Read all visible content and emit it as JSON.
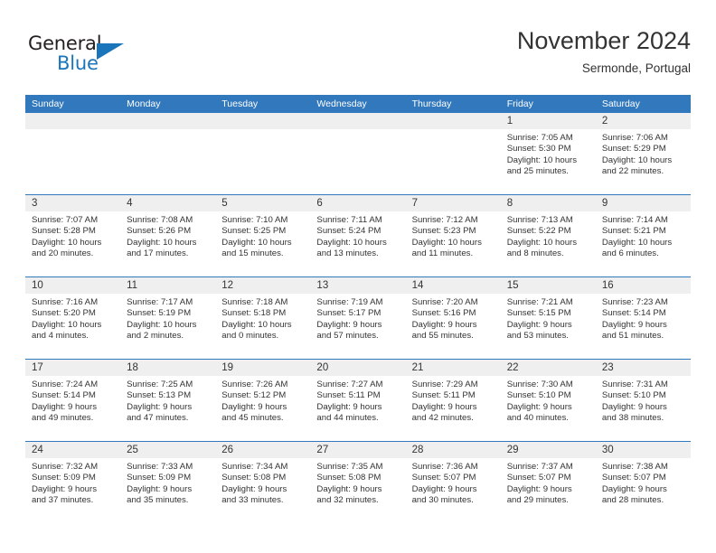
{
  "brand": {
    "name_top": "General",
    "name_bottom": "Blue",
    "triangle_color": "#1b75bb"
  },
  "header": {
    "month_title": "November 2024",
    "location": "Sermonde, Portugal"
  },
  "theme": {
    "header_blue": "#3278bd",
    "daynum_band": "#efefef",
    "text": "#333333"
  },
  "weekdays": [
    "Sunday",
    "Monday",
    "Tuesday",
    "Wednesday",
    "Thursday",
    "Friday",
    "Saturday"
  ],
  "calendar": {
    "weeks": [
      [
        {
          "day": "",
          "empty": true,
          "sunrise": "",
          "sunset": "",
          "daylight1": "",
          "daylight2": ""
        },
        {
          "day": "",
          "empty": true,
          "sunrise": "",
          "sunset": "",
          "daylight1": "",
          "daylight2": ""
        },
        {
          "day": "",
          "empty": true,
          "sunrise": "",
          "sunset": "",
          "daylight1": "",
          "daylight2": ""
        },
        {
          "day": "",
          "empty": true,
          "sunrise": "",
          "sunset": "",
          "daylight1": "",
          "daylight2": ""
        },
        {
          "day": "",
          "empty": true,
          "sunrise": "",
          "sunset": "",
          "daylight1": "",
          "daylight2": ""
        },
        {
          "day": "1",
          "sunrise": "Sunrise: 7:05 AM",
          "sunset": "Sunset: 5:30 PM",
          "daylight1": "Daylight: 10 hours",
          "daylight2": "and 25 minutes."
        },
        {
          "day": "2",
          "sunrise": "Sunrise: 7:06 AM",
          "sunset": "Sunset: 5:29 PM",
          "daylight1": "Daylight: 10 hours",
          "daylight2": "and 22 minutes."
        }
      ],
      [
        {
          "day": "3",
          "sunrise": "Sunrise: 7:07 AM",
          "sunset": "Sunset: 5:28 PM",
          "daylight1": "Daylight: 10 hours",
          "daylight2": "and 20 minutes."
        },
        {
          "day": "4",
          "sunrise": "Sunrise: 7:08 AM",
          "sunset": "Sunset: 5:26 PM",
          "daylight1": "Daylight: 10 hours",
          "daylight2": "and 17 minutes."
        },
        {
          "day": "5",
          "sunrise": "Sunrise: 7:10 AM",
          "sunset": "Sunset: 5:25 PM",
          "daylight1": "Daylight: 10 hours",
          "daylight2": "and 15 minutes."
        },
        {
          "day": "6",
          "sunrise": "Sunrise: 7:11 AM",
          "sunset": "Sunset: 5:24 PM",
          "daylight1": "Daylight: 10 hours",
          "daylight2": "and 13 minutes."
        },
        {
          "day": "7",
          "sunrise": "Sunrise: 7:12 AM",
          "sunset": "Sunset: 5:23 PM",
          "daylight1": "Daylight: 10 hours",
          "daylight2": "and 11 minutes."
        },
        {
          "day": "8",
          "sunrise": "Sunrise: 7:13 AM",
          "sunset": "Sunset: 5:22 PM",
          "daylight1": "Daylight: 10 hours",
          "daylight2": "and 8 minutes."
        },
        {
          "day": "9",
          "sunrise": "Sunrise: 7:14 AM",
          "sunset": "Sunset: 5:21 PM",
          "daylight1": "Daylight: 10 hours",
          "daylight2": "and 6 minutes."
        }
      ],
      [
        {
          "day": "10",
          "sunrise": "Sunrise: 7:16 AM",
          "sunset": "Sunset: 5:20 PM",
          "daylight1": "Daylight: 10 hours",
          "daylight2": "and 4 minutes."
        },
        {
          "day": "11",
          "sunrise": "Sunrise: 7:17 AM",
          "sunset": "Sunset: 5:19 PM",
          "daylight1": "Daylight: 10 hours",
          "daylight2": "and 2 minutes."
        },
        {
          "day": "12",
          "sunrise": "Sunrise: 7:18 AM",
          "sunset": "Sunset: 5:18 PM",
          "daylight1": "Daylight: 10 hours",
          "daylight2": "and 0 minutes."
        },
        {
          "day": "13",
          "sunrise": "Sunrise: 7:19 AM",
          "sunset": "Sunset: 5:17 PM",
          "daylight1": "Daylight: 9 hours",
          "daylight2": "and 57 minutes."
        },
        {
          "day": "14",
          "sunrise": "Sunrise: 7:20 AM",
          "sunset": "Sunset: 5:16 PM",
          "daylight1": "Daylight: 9 hours",
          "daylight2": "and 55 minutes."
        },
        {
          "day": "15",
          "sunrise": "Sunrise: 7:21 AM",
          "sunset": "Sunset: 5:15 PM",
          "daylight1": "Daylight: 9 hours",
          "daylight2": "and 53 minutes."
        },
        {
          "day": "16",
          "sunrise": "Sunrise: 7:23 AM",
          "sunset": "Sunset: 5:14 PM",
          "daylight1": "Daylight: 9 hours",
          "daylight2": "and 51 minutes."
        }
      ],
      [
        {
          "day": "17",
          "sunrise": "Sunrise: 7:24 AM",
          "sunset": "Sunset: 5:14 PM",
          "daylight1": "Daylight: 9 hours",
          "daylight2": "and 49 minutes."
        },
        {
          "day": "18",
          "sunrise": "Sunrise: 7:25 AM",
          "sunset": "Sunset: 5:13 PM",
          "daylight1": "Daylight: 9 hours",
          "daylight2": "and 47 minutes."
        },
        {
          "day": "19",
          "sunrise": "Sunrise: 7:26 AM",
          "sunset": "Sunset: 5:12 PM",
          "daylight1": "Daylight: 9 hours",
          "daylight2": "and 45 minutes."
        },
        {
          "day": "20",
          "sunrise": "Sunrise: 7:27 AM",
          "sunset": "Sunset: 5:11 PM",
          "daylight1": "Daylight: 9 hours",
          "daylight2": "and 44 minutes."
        },
        {
          "day": "21",
          "sunrise": "Sunrise: 7:29 AM",
          "sunset": "Sunset: 5:11 PM",
          "daylight1": "Daylight: 9 hours",
          "daylight2": "and 42 minutes."
        },
        {
          "day": "22",
          "sunrise": "Sunrise: 7:30 AM",
          "sunset": "Sunset: 5:10 PM",
          "daylight1": "Daylight: 9 hours",
          "daylight2": "and 40 minutes."
        },
        {
          "day": "23",
          "sunrise": "Sunrise: 7:31 AM",
          "sunset": "Sunset: 5:10 PM",
          "daylight1": "Daylight: 9 hours",
          "daylight2": "and 38 minutes."
        }
      ],
      [
        {
          "day": "24",
          "sunrise": "Sunrise: 7:32 AM",
          "sunset": "Sunset: 5:09 PM",
          "daylight1": "Daylight: 9 hours",
          "daylight2": "and 37 minutes."
        },
        {
          "day": "25",
          "sunrise": "Sunrise: 7:33 AM",
          "sunset": "Sunset: 5:09 PM",
          "daylight1": "Daylight: 9 hours",
          "daylight2": "and 35 minutes."
        },
        {
          "day": "26",
          "sunrise": "Sunrise: 7:34 AM",
          "sunset": "Sunset: 5:08 PM",
          "daylight1": "Daylight: 9 hours",
          "daylight2": "and 33 minutes."
        },
        {
          "day": "27",
          "sunrise": "Sunrise: 7:35 AM",
          "sunset": "Sunset: 5:08 PM",
          "daylight1": "Daylight: 9 hours",
          "daylight2": "and 32 minutes."
        },
        {
          "day": "28",
          "sunrise": "Sunrise: 7:36 AM",
          "sunset": "Sunset: 5:07 PM",
          "daylight1": "Daylight: 9 hours",
          "daylight2": "and 30 minutes."
        },
        {
          "day": "29",
          "sunrise": "Sunrise: 7:37 AM",
          "sunset": "Sunset: 5:07 PM",
          "daylight1": "Daylight: 9 hours",
          "daylight2": "and 29 minutes."
        },
        {
          "day": "30",
          "sunrise": "Sunrise: 7:38 AM",
          "sunset": "Sunset: 5:07 PM",
          "daylight1": "Daylight: 9 hours",
          "daylight2": "and 28 minutes."
        }
      ]
    ]
  }
}
